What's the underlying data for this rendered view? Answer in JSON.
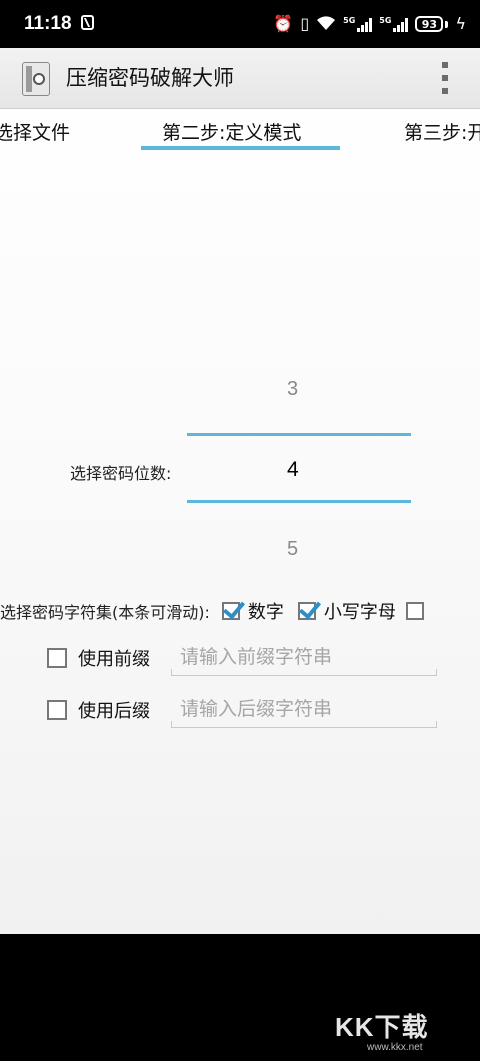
{
  "status": {
    "time": "11:18",
    "net_5g_1": "5G",
    "net_5g_2": "5G",
    "battery": "93"
  },
  "app": {
    "title": "压缩密码破解大师",
    "icon": "zip-lock-icon",
    "menu_icon": "overflow-menu-icon"
  },
  "tabs": [
    {
      "label": "选择文件"
    },
    {
      "label": "第二步:定义模式",
      "selected": true
    },
    {
      "label": "第三步:开"
    }
  ],
  "digits": {
    "label": "选择密码位数:",
    "prev": "3",
    "current": "4",
    "next": "5"
  },
  "charset": {
    "label": "选择密码字符集(本条可滑动):",
    "options": [
      {
        "label": "数字",
        "checked": true
      },
      {
        "label": "小写字母",
        "checked": true
      }
    ]
  },
  "prefix": {
    "label": "使用前缀",
    "checked": false,
    "placeholder": "请输入前缀字符串",
    "value": ""
  },
  "suffix": {
    "label": "使用后缀",
    "checked": false,
    "placeholder": "请输入后缀字符串",
    "value": ""
  },
  "colors": {
    "accent": "#5bb7db",
    "check": "#2e8fc7"
  },
  "watermark": {
    "main": "KK下载",
    "sub": "www.kkx.net"
  }
}
